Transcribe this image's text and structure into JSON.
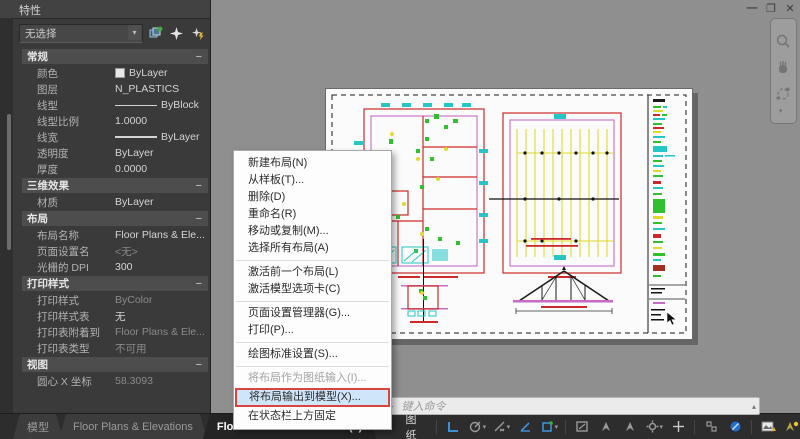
{
  "window": {
    "controls": {
      "minimize": "—",
      "restore": "❐",
      "close": "✕"
    }
  },
  "properties_panel": {
    "title": "特性",
    "no_selection": "无选择",
    "collapse_glyph": "−",
    "sections": [
      {
        "title": "常规",
        "rows": [
          {
            "label": "颜色",
            "value": "ByLayer"
          },
          {
            "label": "图层",
            "value": "N_PLASTICS"
          },
          {
            "label": "线型",
            "value": "ByBlock"
          },
          {
            "label": "线型比例",
            "value": "1.0000"
          },
          {
            "label": "线宽",
            "value": "ByLayer"
          },
          {
            "label": "透明度",
            "value": "ByLayer"
          },
          {
            "label": "厚度",
            "value": "0.0000"
          }
        ]
      },
      {
        "title": "三维效果",
        "rows": [
          {
            "label": "材质",
            "value": "ByLayer"
          }
        ]
      },
      {
        "title": "布局",
        "rows": [
          {
            "label": "布局名称",
            "value": "Floor Plans & Ele..."
          },
          {
            "label": "页面设置名",
            "value": "<无>"
          },
          {
            "label": "光栅的 DPI",
            "value": "300"
          }
        ]
      },
      {
        "title": "打印样式",
        "rows": [
          {
            "label": "打印样式",
            "value": "ByColor"
          },
          {
            "label": "打印样式表",
            "value": "无"
          },
          {
            "label": "打印表附着到",
            "value": "Floor Plans & Ele..."
          },
          {
            "label": "打印表类型",
            "value": "不可用"
          }
        ]
      },
      {
        "title": "视图",
        "rows": [
          {
            "label": "圆心 X 坐标",
            "value": "58.3093"
          }
        ]
      }
    ]
  },
  "context_menu": {
    "items": [
      {
        "label": "新建布局(N)"
      },
      {
        "label": "从样板(T)..."
      },
      {
        "label": "删除(D)"
      },
      {
        "label": "重命名(R)"
      },
      {
        "label": "移动或复制(M)..."
      },
      {
        "label": "选择所有布局(A)"
      },
      {
        "label": "激活前一个布局(L)"
      },
      {
        "label": "激活模型选项卡(C)"
      },
      {
        "label": "页面设置管理器(G)..."
      },
      {
        "label": "打印(P)..."
      },
      {
        "label": "绘图标准设置(S)..."
      },
      {
        "label": "将布局作为图纸输入(I)...",
        "state": "disabled"
      },
      {
        "label": "将布局输出到模型(X)...",
        "state": "highlighted"
      },
      {
        "label": "在状态栏上方固定"
      }
    ]
  },
  "layout_tabs": {
    "tabs": [
      {
        "label": "模型"
      },
      {
        "label": "Floor Plans & Elevations"
      },
      {
        "label": "Floor Plans & Elevations (2)",
        "active": true
      }
    ]
  },
  "command_line": {
    "prompt": "键入命令"
  },
  "status_bar": {
    "paper_label": "图纸"
  },
  "colors": {
    "canvas_bg": "#8f8f8f",
    "paper": "#fbfbfb",
    "cad_red": "#cc2a2a",
    "cad_magenta": "#c76bc7",
    "cad_yellow": "#e0da2e",
    "cad_cyan": "#27c6c6",
    "cad_green": "#2fbf2f",
    "accent_blue": "#3f8fd6",
    "highlight_bg": "#cfe6fa",
    "highlight_border": "#d9453c"
  }
}
